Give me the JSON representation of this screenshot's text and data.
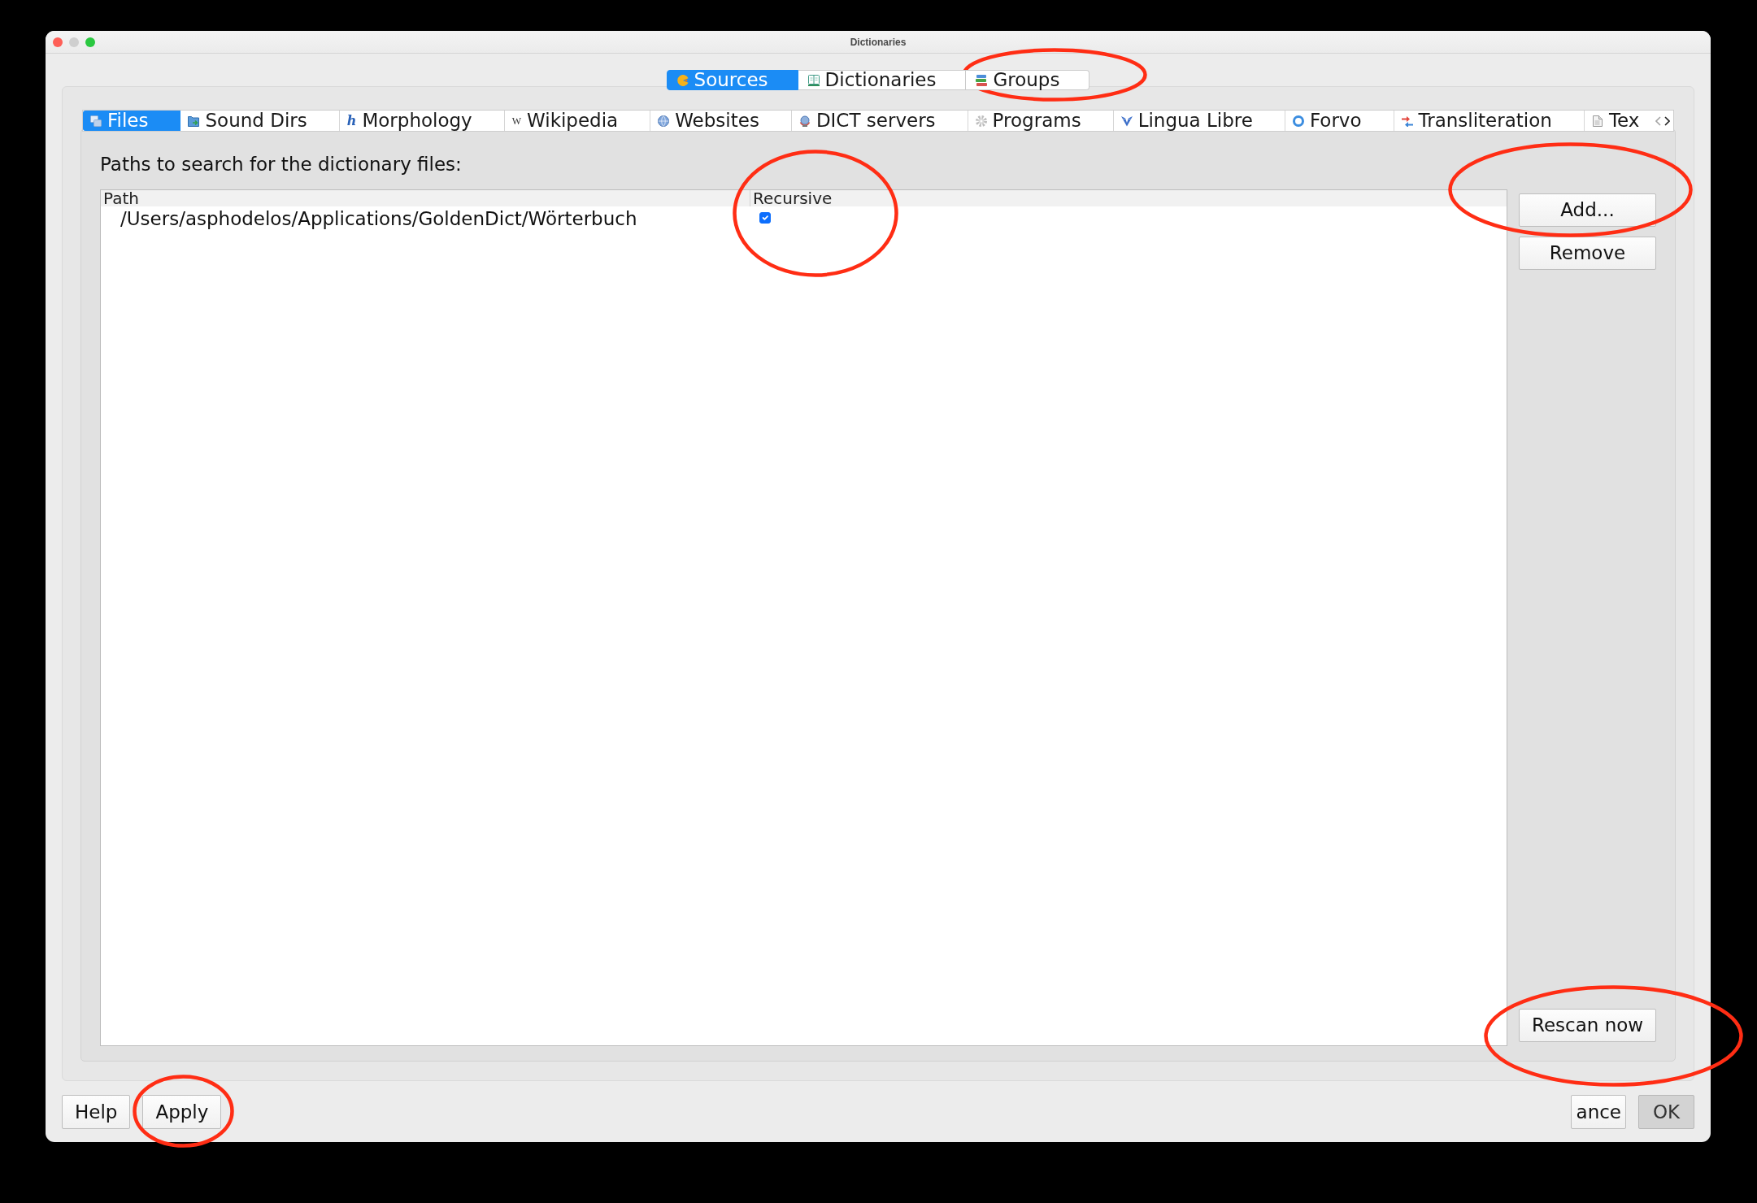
{
  "window": {
    "title": "Dictionaries"
  },
  "top_tabs": [
    {
      "label": "Sources",
      "selected": true,
      "circled": false
    },
    {
      "label": "Dictionaries",
      "selected": false,
      "circled": false
    },
    {
      "label": "Groups",
      "selected": false,
      "circled": true
    }
  ],
  "source_tabs": [
    {
      "label": "Files",
      "selected": true
    },
    {
      "label": "Sound Dirs",
      "selected": false
    },
    {
      "label": "Morphology",
      "glyph": "h",
      "selected": false
    },
    {
      "label": "Wikipedia",
      "glyph": "W",
      "selected": false
    },
    {
      "label": "Websites",
      "selected": false
    },
    {
      "label": "DICT servers",
      "selected": false
    },
    {
      "label": "Programs",
      "selected": false
    },
    {
      "label": "Lingua Libre",
      "selected": false
    },
    {
      "label": "Forvo",
      "selected": false
    },
    {
      "label": "Transliteration",
      "selected": false
    },
    {
      "label": "Tex",
      "selected": false
    }
  ],
  "files_panel": {
    "heading": "Paths to search for the dictionary files:",
    "table": {
      "columns": [
        {
          "label": "Path",
          "circled": false
        },
        {
          "label": "Recursive",
          "circled": true
        }
      ],
      "rows": [
        {
          "path": "/Users/asphodelos/Applications/GoldenDict/Wörterbuch",
          "recursive": true
        }
      ]
    },
    "side_buttons": [
      {
        "label": "Add...",
        "circled": true
      },
      {
        "label": "Remove",
        "circled": false
      }
    ],
    "rescan_button": {
      "label": "Rescan now",
      "circled": true
    }
  },
  "footer": {
    "left_buttons": [
      {
        "label": "Help",
        "circled": false
      },
      {
        "label": "Apply",
        "circled": true
      }
    ],
    "right_buttons": [
      {
        "label": "ance",
        "default": false
      },
      {
        "label": "OK",
        "default": true
      }
    ]
  }
}
